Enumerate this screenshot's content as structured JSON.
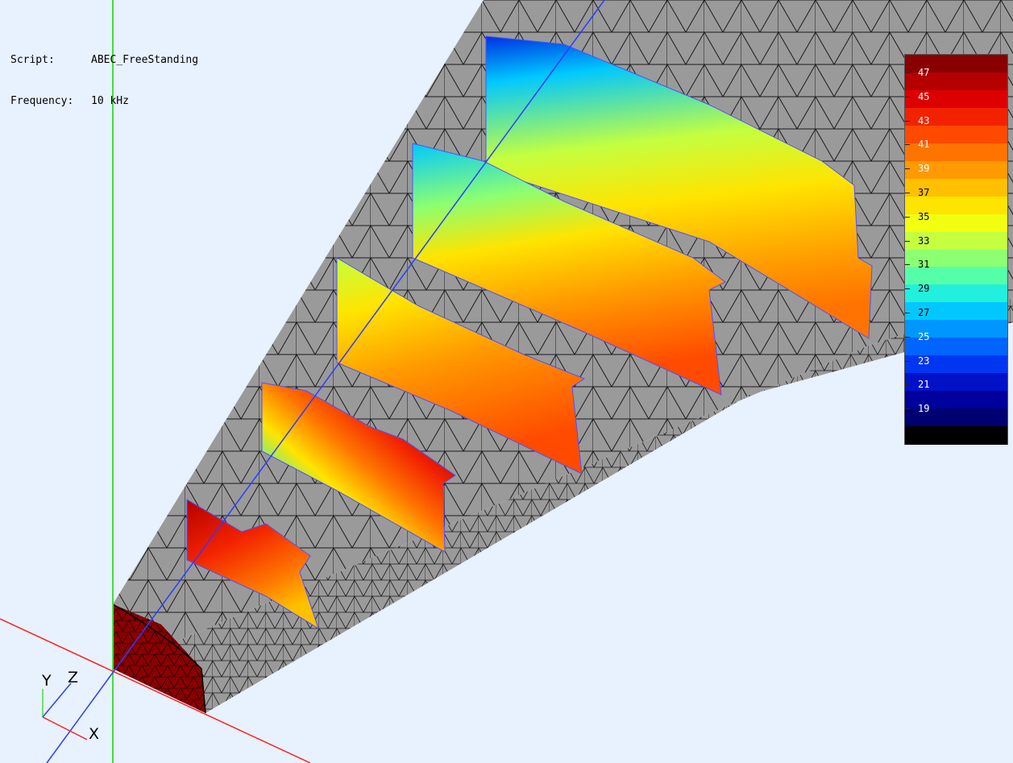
{
  "info": {
    "script_label": "Script:",
    "script_value": "ABEC_FreeStanding",
    "freq_label": "Frequency:",
    "freq_value": "10 kHz"
  },
  "legend": {
    "labels": [
      "47",
      "45",
      "43",
      "41",
      "39",
      "37",
      "35",
      "33",
      "31",
      "29",
      "27",
      "25",
      "23",
      "21",
      "19"
    ],
    "colors": [
      "#8a0000",
      "#b50000",
      "#dd0000",
      "#f22200",
      "#ff4a00",
      "#ff7400",
      "#ff9a00",
      "#ffc000",
      "#ffe400",
      "#f2ff10",
      "#c4ff40",
      "#8cff72",
      "#55ffa8",
      "#22f0dc",
      "#00c8ff",
      "#0096ff",
      "#0064ff",
      "#0036f0",
      "#0012c8",
      "#00009c",
      "#000070",
      "#000000"
    ]
  },
  "axes": {
    "x": "X",
    "y": "Y",
    "z": "Z"
  },
  "colors": {
    "mesh": "#9a9a9a",
    "background": "#e8f1fe",
    "x_axis": "#ff2020",
    "y_axis": "#40e040",
    "z_axis": "#2b3dff"
  }
}
